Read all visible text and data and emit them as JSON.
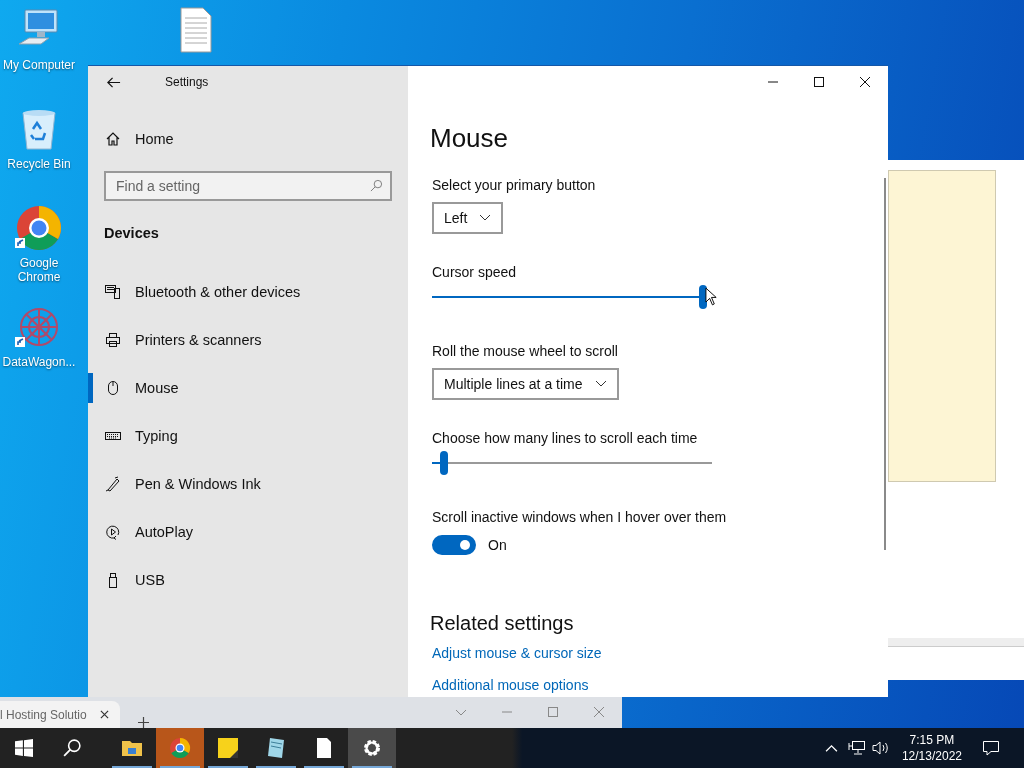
{
  "desktop": {
    "icon_columns": [
      [
        {
          "kind": "computer",
          "label": "My Computer",
          "shortcut": false
        },
        {
          "kind": "recycle",
          "label": "Recycle Bin",
          "shortcut": false
        },
        {
          "kind": "chrome",
          "label": "Google Chrome",
          "shortcut": true
        },
        {
          "kind": "datawagon",
          "label": "DataWagon...",
          "shortcut": true
        }
      ],
      [
        {
          "kind": "document",
          "shortcut": false
        }
      ]
    ]
  },
  "browser": {
    "tab": {
      "title": "l Hosting Solutio"
    }
  },
  "settings": {
    "title": "Settings",
    "home": "Home",
    "search_placeholder": "Find a setting",
    "section": "Devices",
    "items": [
      {
        "kind": "bluetooth",
        "label": "Bluetooth & other devices",
        "selected": false
      },
      {
        "kind": "printer",
        "label": "Printers & scanners",
        "selected": false
      },
      {
        "kind": "mouse",
        "label": "Mouse",
        "selected": true
      },
      {
        "kind": "keyboard",
        "label": "Typing",
        "selected": false
      },
      {
        "kind": "pen",
        "label": "Pen & Windows Ink",
        "selected": false
      },
      {
        "kind": "autoplay",
        "label": "AutoPlay",
        "selected": false
      },
      {
        "kind": "usb",
        "label": "USB",
        "selected": false
      }
    ],
    "page": {
      "heading": "Mouse",
      "primary_button": {
        "label": "Select your primary button",
        "value": "Left"
      },
      "cursor_speed": {
        "label": "Cursor speed",
        "level": 0.98
      },
      "wheel_scroll": {
        "label": "Roll the mouse wheel to scroll",
        "value": "Multiple lines at a time"
      },
      "scroll_lines": {
        "label": "Choose how many lines to scroll each time",
        "level": 0.03
      },
      "inactive_scroll": {
        "label": "Scroll inactive windows when I hover over them",
        "on": true,
        "state": "On"
      },
      "related": {
        "heading": "Related settings",
        "links": [
          "Adjust mouse & cursor size",
          "Additional mouse options"
        ]
      }
    }
  },
  "taskbar": {
    "apps": [
      {
        "kind": "explorer",
        "attention": false,
        "selected": false
      },
      {
        "kind": "chrome",
        "attention": true,
        "selected": false
      },
      {
        "kind": "sticky",
        "attention": false,
        "selected": false
      },
      {
        "kind": "notepad",
        "attention": false,
        "selected": false
      },
      {
        "kind": "document",
        "attention": false,
        "selected": false
      },
      {
        "kind": "settings",
        "attention": false,
        "selected": true
      }
    ],
    "clock": {
      "time": "7:15 PM",
      "date": "12/13/2022"
    }
  }
}
